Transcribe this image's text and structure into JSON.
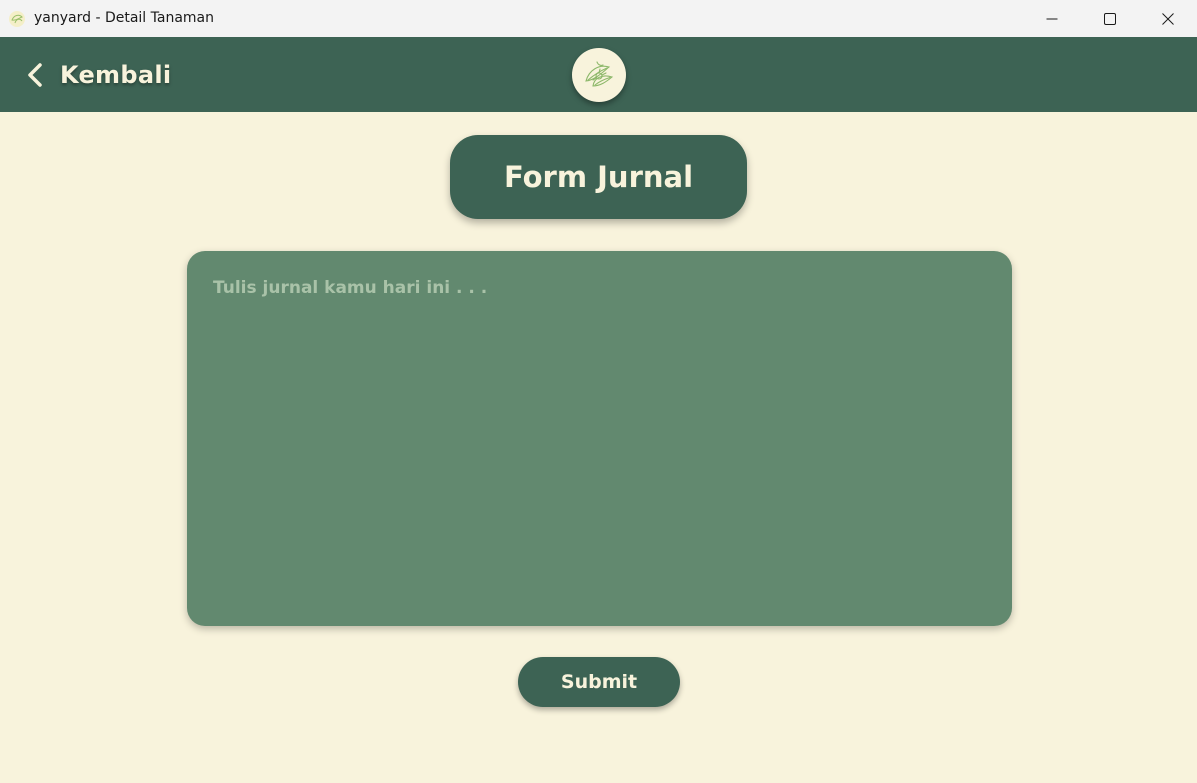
{
  "window": {
    "title": "yanyard - Detail Tanaman",
    "controls": [
      "minimize-icon",
      "maximize-icon",
      "close-icon"
    ]
  },
  "header": {
    "back_label": "Kembali",
    "back_icon": "chevron-left-icon",
    "logo_icon": "plant-logo-icon"
  },
  "form": {
    "title": "Form Jurnal",
    "journal_value": "",
    "journal_placeholder": "Tulis jurnal kamu hari ini . . .",
    "submit_label": "Submit"
  },
  "colors": {
    "background": "#F8F3DC",
    "primary": "#3D6354",
    "textarea": "#62896F",
    "text_light": "#F8F3DC",
    "placeholder": "#A9C2A8"
  }
}
